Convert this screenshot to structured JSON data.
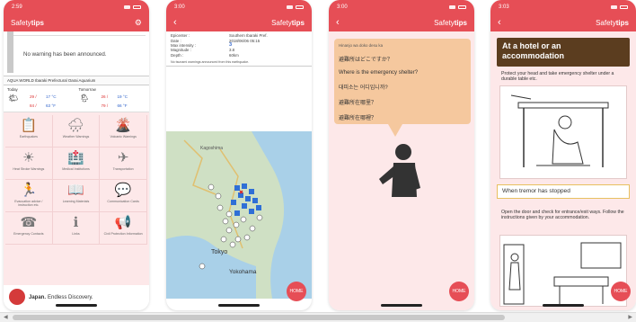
{
  "colors": {
    "accent": "#e64e56",
    "brown": "#5b3d1f",
    "pink_bg": "#fde8e9",
    "bubble": "#f5c89e"
  },
  "phone1": {
    "time": "2:59",
    "title_prefix": "Safety",
    "title_bold": "tips",
    "warning": "No warning has been announced.",
    "location": "AQUA WORLD Ibaraki Prefectural Oarai Aquarium",
    "today": {
      "label": "Today",
      "hi": "29 /",
      "hi_unit": "17 °C",
      "lo": "84 /",
      "lo_unit": "63 °F"
    },
    "tomorrow": {
      "label": "Tomorrow",
      "hi": "26 /",
      "hi_unit": "19 °C",
      "lo": "79 /",
      "lo_unit": "66 °F"
    },
    "tiles": [
      {
        "label": "Earthquakes",
        "icon": "📋"
      },
      {
        "label": "Weather Warnings",
        "icon": "🌧"
      },
      {
        "label": "Volcanic Warnings",
        "icon": "🌋"
      },
      {
        "label": "Heat Stroke Warnings",
        "icon": "☀"
      },
      {
        "label": "Medical Institutions",
        "icon": "🏥"
      },
      {
        "label": "Transportation",
        "icon": "✈"
      },
      {
        "label": "Evacuation advice / instruction etc.",
        "icon": "🏃"
      },
      {
        "label": "Learning Materials",
        "icon": "📖"
      },
      {
        "label": "Communication Cards",
        "icon": "💬"
      },
      {
        "label": "Emergency Contacts",
        "icon": "☎"
      },
      {
        "label": "Links",
        "icon": "ℹ"
      },
      {
        "label": "Civil Protection Information",
        "icon": "📢"
      }
    ],
    "footer_brand": "Japan.",
    "footer_tag": "Endless Discovery."
  },
  "phone2": {
    "time": "3:00",
    "title_prefix": "Safety",
    "title_bold": "tips",
    "rows": [
      {
        "k": "Epicenter :",
        "v": "Southern Ibaraki Pref."
      },
      {
        "k": "Date :",
        "v": "2018/06/06 05:15"
      },
      {
        "k": "Max intensity :",
        "v": "3"
      },
      {
        "k": "Magnitude :",
        "v": "3.8"
      },
      {
        "k": "Depth :",
        "v": "60km"
      }
    ],
    "tsunami": "No tsunami warnings announced from this earthquake.",
    "map_labels": {
      "kagoshima": "Kagoshima",
      "tokyo": "Tokyo",
      "yokohama": "Yokohama"
    },
    "home": "HOME"
  },
  "phone3": {
    "time": "3:00",
    "title_prefix": "Safety",
    "title_bold": "tips",
    "romaji": "Hinanjo wa doko desu ka",
    "lines": [
      "避難所はどこですか？",
      "Where is the emergency shelter?",
      "대피소는 어디입니까?",
      "避難所在哪里？",
      "避難所在哪裡？"
    ],
    "home": "HOME"
  },
  "phone4": {
    "time": "3:03",
    "title_prefix": "Safety",
    "title_bold": "tips",
    "card1": "At a hotel or an accommodation",
    "text1": "Protect your head and take emergency shelter under a durable table etc.",
    "card2": "When tremor has stopped",
    "text2": "Open the door and check for entrance/exit ways. Follow the instructions given by your accommodation.",
    "home": "HOME"
  }
}
